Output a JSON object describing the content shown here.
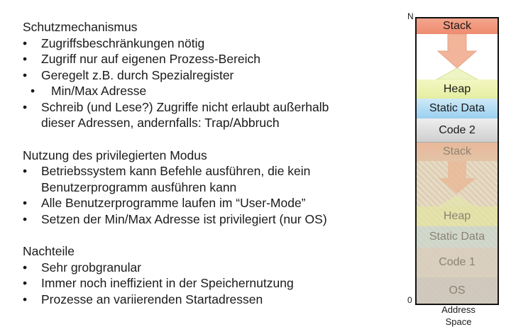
{
  "section1": {
    "heading": "Schutzmechanismus",
    "items": [
      "Zugriffsbeschränkungen nötig",
      "Zugriff nur auf eigenen Prozess-Bereich",
      "Geregelt z.B. durch Spezialregister",
      "Min/Max Adresse",
      "Schreib (und Lese?) Zugriffe nicht erlaubt außerhalb",
      "dieser Adressen, andernfalls: Trap/Abbruch"
    ]
  },
  "section2": {
    "heading": "Nutzung des privilegierten Modus",
    "items": [
      "Betriebssystem kann Befehle ausführen, die kein",
      "Benutzerprogramm ausführen kann",
      "Alle Benutzerprogramme laufen im “User-Mode”",
      "Setzen der Min/Max Adresse ist privilegiert (nur OS)"
    ]
  },
  "section3": {
    "heading": "Nachteile",
    "items": [
      "Sehr grobgranular",
      "Immer noch ineffizient in der Speichernutzung",
      "Prozesse an variierenden Startadressen"
    ]
  },
  "diagram": {
    "top_label": "N",
    "zero_label": "0",
    "caption_line1": "Address",
    "caption_line2": "Space",
    "segments": {
      "stack": "Stack",
      "heap": "Heap",
      "static_data": "Static Data",
      "code2": "Code 2",
      "faded_stack": "Stack",
      "faded_heap": "Heap",
      "faded_static_data": "Static Data",
      "faded_code1": "Code 1",
      "faded_os": "OS"
    },
    "colors": {
      "stack": "#ee8c70",
      "heap": "#e3eea0",
      "static_data": "#9ad0f0",
      "code": "#cfcfcf",
      "faded_background": "#e9dcc6"
    }
  }
}
